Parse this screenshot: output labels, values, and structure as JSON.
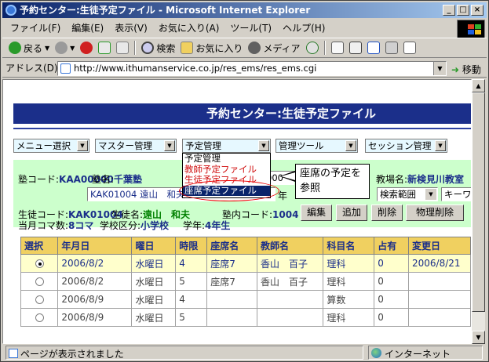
{
  "window": {
    "title": "予約センター:生徒予定ファイル - Microsoft Internet Explorer",
    "min": "_",
    "max": "□",
    "close": "×"
  },
  "menubar": [
    "ファイル(F)",
    "編集(E)",
    "表示(V)",
    "お気に入り(A)",
    "ツール(T)",
    "ヘルプ(H)"
  ],
  "toolbar": {
    "back": "戻る",
    "search": "検索",
    "favorites": "お気に入り",
    "media": "メディア"
  },
  "address": {
    "label": "アドレス(D)",
    "url": "http://www.ithumanservice.co.jp/res_ems/res_ems.cgi",
    "go": "移動"
  },
  "page": {
    "title": "予約センター:生徒予定ファイル",
    "nav": [
      {
        "label": "メニュー選択"
      },
      {
        "label": "マスター管理"
      },
      {
        "label": "予定管理"
      },
      {
        "label": "管理ツール"
      },
      {
        "label": "セッション管理"
      }
    ],
    "dropdown": {
      "items": [
        "予定管理",
        "教師予定ファイル",
        "生徒予定ファイル",
        "座席予定ファイル"
      ]
    },
    "callout": "座席の予定を参照",
    "school": {
      "code_label": "塾コード:",
      "code": "KAA00000",
      "name_label": "塾名:",
      "name": "千葉塾",
      "right_value": "000",
      "room_label": "教場名:",
      "room": "新検見川教室"
    },
    "seat_select": "KAK01004 遠山　和夫",
    "year_label": "年",
    "search_range": "検索範囲",
    "keyword": "キーワ",
    "student": {
      "code_label": "生徒コード:",
      "code": "KAK01004",
      "name_label": "生徒名:",
      "name": "遠山　和夫",
      "incode_label": "塾内コード:",
      "incode": "1004",
      "month_label": "当月コマ数:",
      "month": "8コマ",
      "school_type_label": "学校区分:",
      "school_type": "小学校",
      "grade_label": "学年:",
      "grade": "4年生"
    },
    "buttons": {
      "edit": "編集",
      "add": "追加",
      "delete": "削除",
      "phys_delete": "物理削除"
    },
    "table": {
      "headers": [
        "選択",
        "年月日",
        "曜日",
        "時限",
        "座席名",
        "教師名",
        "科目名",
        "占有",
        "変更日"
      ],
      "rows": [
        {
          "date": "2006/8/2",
          "dow": "水曜日",
          "period": "4",
          "seat": "座席7",
          "teacher": "香山　百子",
          "subject": "理科",
          "occ": "0",
          "changed": "2006/8/21",
          "selected": true
        },
        {
          "date": "2006/8/2",
          "dow": "水曜日",
          "period": "5",
          "seat": "座席7",
          "teacher": "香山　百子",
          "subject": "理科",
          "occ": "0",
          "changed": "",
          "selected": false
        },
        {
          "date": "2006/8/9",
          "dow": "水曜日",
          "period": "4",
          "seat": "",
          "teacher": "",
          "subject": "算数",
          "occ": "0",
          "changed": "",
          "selected": false
        },
        {
          "date": "2006/8/9",
          "dow": "水曜日",
          "period": "5",
          "seat": "",
          "teacher": "",
          "subject": "理科",
          "occ": "0",
          "changed": "",
          "selected": false
        }
      ]
    }
  },
  "status": {
    "left": "ページが表示されました",
    "zone": "インターネット"
  }
}
